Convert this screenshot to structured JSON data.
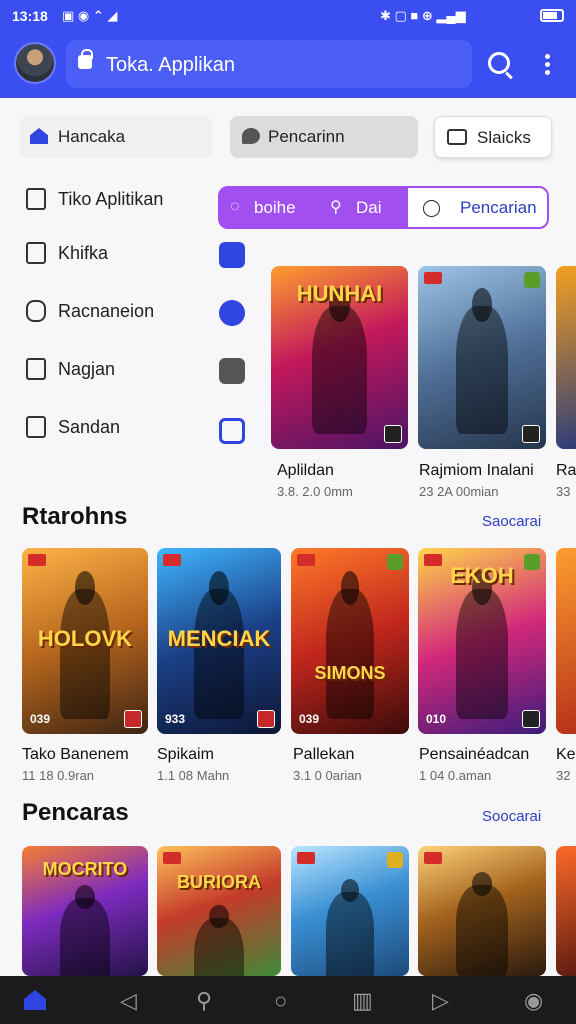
{
  "status": {
    "time": "13:18"
  },
  "appbar": {
    "search_text": "Toka. Applikan"
  },
  "chips": [
    {
      "label": "Hancaka"
    },
    {
      "label": "Pencarinn"
    },
    {
      "label": "Slaicks"
    }
  ],
  "tabs": [
    {
      "label": "boihe"
    },
    {
      "label": "Dai"
    },
    {
      "label": "Pencarian"
    }
  ],
  "sidebar": {
    "items": [
      {
        "label": "Tiko Aplitikan"
      },
      {
        "label": "Khifka"
      },
      {
        "label": "Racnaneion"
      },
      {
        "label": "Nagjan"
      },
      {
        "label": "Sandan"
      }
    ]
  },
  "featured": [
    {
      "title": "Aplildan",
      "sub": "3.8. 2.0 0mm",
      "logo": "HUNHAI",
      "num": "",
      "bg": "linear-gradient(160deg,#ff9d2f,#c2185b 45%,#4a1466)"
    },
    {
      "title": "Rajmiom Inalani",
      "sub": "23 2A 00mian",
      "logo": "",
      "num": "",
      "bg": "linear-gradient(160deg,#9ec4e6,#4f6f96 50%,#26354d)"
    },
    {
      "title": "Ra",
      "sub": "33",
      "logo": "",
      "num": "",
      "bg": "linear-gradient(160deg,#f5a020,#2a3b7a)"
    }
  ],
  "section1": {
    "title": "Rtarohns",
    "see_more": "Saocarai"
  },
  "row1": [
    {
      "title": "Tako Banenem",
      "sub": "11 18 0.9ran",
      "logo": "HOLOVK",
      "num": "039",
      "bg": "linear-gradient(160deg,#ffb347,#b5651d 50%,#3d2413)"
    },
    {
      "title": "Spikaim",
      "sub": "1.1 08 Mahn",
      "logo": "MENCIAK",
      "num": "933",
      "bg": "linear-gradient(160deg,#3fb6ff,#1b3f86 50%,#0d1633)"
    },
    {
      "title": "Pallekan",
      "sub": "3.1 0 0arian",
      "logo": "SIMONS",
      "num": "039",
      "bg": "linear-gradient(160deg,#ff7a2a,#c0261c 50%,#3a0b0b)"
    },
    {
      "title": "Pensainéadcan",
      "sub": "1 04 0.aman",
      "logo": "EKOH",
      "num": "010",
      "bg": "linear-gradient(160deg,#ffd54a,#d2287a 50%,#3b1c7a)"
    },
    {
      "title": "Ke",
      "sub": "32",
      "logo": "",
      "num": "",
      "bg": "linear-gradient(160deg,#ff9d2f,#b5301a)"
    }
  ],
  "section2": {
    "title": "Pencaras",
    "see_more": "Soocarai"
  },
  "row2": [
    {
      "logo": "MOCRITO",
      "bg": "linear-gradient(160deg,#f77d32,#7e2bbf 45%,#241347)"
    },
    {
      "logo": "BURIORA",
      "bg": "linear-gradient(160deg,#ffc15a,#c43b2a 45%,#3f8a3a)"
    },
    {
      "logo": "",
      "bg": "linear-gradient(160deg,#b9e6ff,#3a8fd4 45%,#1d4a7a)"
    },
    {
      "logo": "",
      "bg": "linear-gradient(160deg,#ffd27a,#a2621d 45%,#2a1a0e)"
    },
    {
      "logo": "",
      "bg": "linear-gradient(160deg,#ff6a2a,#5a1a0e)"
    }
  ],
  "colors": {
    "primary": "#3a4ef2",
    "accent": "#a24ff0",
    "link": "#2d3ec0"
  }
}
